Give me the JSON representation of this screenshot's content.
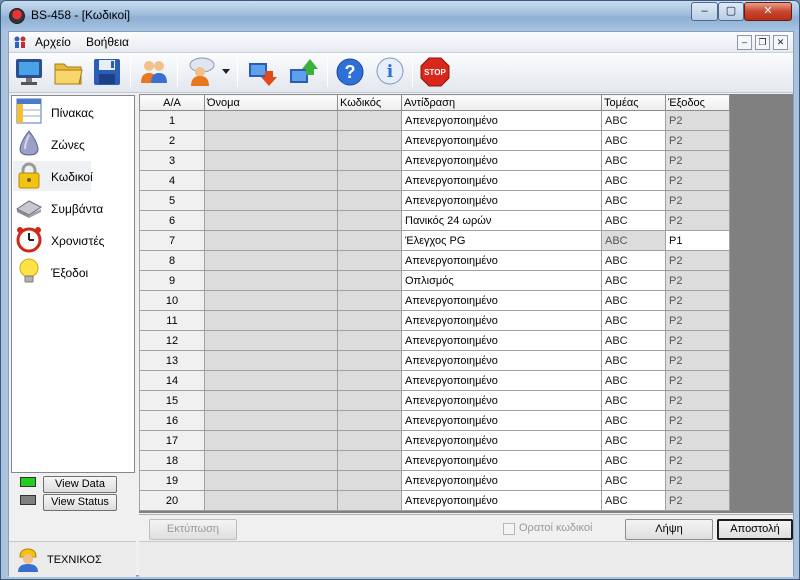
{
  "window": {
    "title": "BS-458 - [Κωδικοί]"
  },
  "menu": {
    "items": [
      "Αρχείο",
      "Βοήθεια"
    ]
  },
  "toolbar": {
    "buttons": [
      "monitor-icon",
      "open-folder-icon",
      "save-disk-icon",
      "users-icon",
      "user-options-icon",
      "download-icon",
      "upload-icon",
      "help-icon",
      "info-icon",
      "stop-icon"
    ]
  },
  "sidebar": {
    "items": [
      {
        "label": "Πίνακας",
        "icon": "panel-icon"
      },
      {
        "label": "Ζώνες",
        "icon": "zones-icon"
      },
      {
        "label": "Κωδικοί",
        "icon": "lock-icon"
      },
      {
        "label": "Συμβάντα",
        "icon": "events-icon"
      },
      {
        "label": "Χρονιστές",
        "icon": "alarm-clock-icon"
      },
      {
        "label": "Έξοδοι",
        "icon": "bulb-icon"
      }
    ],
    "view_data_label": "View Data",
    "view_status_label": "View Status",
    "led_colors": {
      "data": "#22cc22",
      "status": "#808080"
    }
  },
  "user": {
    "label": "ΤΕΧΝΙΚΟΣ"
  },
  "table": {
    "columns": [
      "Α/Α",
      "Όνομα",
      "Κωδικός",
      "Αντίδραση",
      "Τομέας",
      "Έξοδος"
    ],
    "rows": [
      {
        "aa": "1",
        "name": "",
        "code": "",
        "reaction": "Απενεργοποιημένο",
        "sector": "ABC",
        "exit": "P2"
      },
      {
        "aa": "2",
        "name": "",
        "code": "",
        "reaction": "Απενεργοποιημένο",
        "sector": "ABC",
        "exit": "P2"
      },
      {
        "aa": "3",
        "name": "",
        "code": "",
        "reaction": "Απενεργοποιημένο",
        "sector": "ABC",
        "exit": "P2"
      },
      {
        "aa": "4",
        "name": "",
        "code": "",
        "reaction": "Απενεργοποιημένο",
        "sector": "ABC",
        "exit": "P2"
      },
      {
        "aa": "5",
        "name": "",
        "code": "",
        "reaction": "Απενεργοποιημένο",
        "sector": "ABC",
        "exit": "P2"
      },
      {
        "aa": "6",
        "name": "",
        "code": "",
        "reaction": "Πανικός 24 ωρών",
        "sector": "ABC",
        "exit": "P2"
      },
      {
        "aa": "7",
        "name": "",
        "code": "",
        "reaction": "Έλεγχος PG",
        "sector": "ABC",
        "exit": "P1"
      },
      {
        "aa": "8",
        "name": "",
        "code": "",
        "reaction": "Απενεργοποιημένο",
        "sector": "ABC",
        "exit": "P2"
      },
      {
        "aa": "9",
        "name": "",
        "code": "",
        "reaction": "Οπλισμός",
        "sector": "ABC",
        "exit": "P2"
      },
      {
        "aa": "10",
        "name": "",
        "code": "",
        "reaction": "Απενεργοποιημένο",
        "sector": "ABC",
        "exit": "P2"
      },
      {
        "aa": "11",
        "name": "",
        "code": "",
        "reaction": "Απενεργοποιημένο",
        "sector": "ABC",
        "exit": "P2"
      },
      {
        "aa": "12",
        "name": "",
        "code": "",
        "reaction": "Απενεργοποιημένο",
        "sector": "ABC",
        "exit": "P2"
      },
      {
        "aa": "13",
        "name": "",
        "code": "",
        "reaction": "Απενεργοποιημένο",
        "sector": "ABC",
        "exit": "P2"
      },
      {
        "aa": "14",
        "name": "",
        "code": "",
        "reaction": "Απενεργοποιημένο",
        "sector": "ABC",
        "exit": "P2"
      },
      {
        "aa": "15",
        "name": "",
        "code": "",
        "reaction": "Απενεργοποιημένο",
        "sector": "ABC",
        "exit": "P2"
      },
      {
        "aa": "16",
        "name": "",
        "code": "",
        "reaction": "Απενεργοποιημένο",
        "sector": "ABC",
        "exit": "P2"
      },
      {
        "aa": "17",
        "name": "",
        "code": "",
        "reaction": "Απενεργοποιημένο",
        "sector": "ABC",
        "exit": "P2"
      },
      {
        "aa": "18",
        "name": "",
        "code": "",
        "reaction": "Απενεργοποιημένο",
        "sector": "ABC",
        "exit": "P2"
      },
      {
        "aa": "19",
        "name": "",
        "code": "",
        "reaction": "Απενεργοποιημένο",
        "sector": "ABC",
        "exit": "P2"
      },
      {
        "aa": "20",
        "name": "",
        "code": "",
        "reaction": "Απενεργοποιημένο",
        "sector": "ABC",
        "exit": "P2"
      }
    ]
  },
  "actions": {
    "print_label": "Εκτύπωση",
    "visible_codes_label": "Ορατοί κωδικοί",
    "receive_label": "Λήψη",
    "send_label": "Αποστολή"
  }
}
